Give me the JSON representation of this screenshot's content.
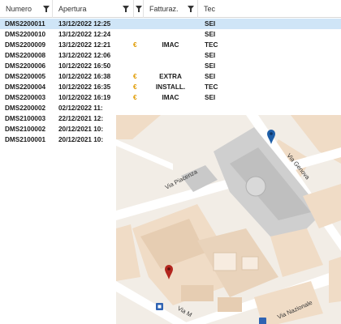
{
  "grid": {
    "columns": [
      {
        "label": "Numero",
        "filter": true
      },
      {
        "label": "Apertura",
        "filter": true
      },
      {
        "label": "",
        "filter": true
      },
      {
        "label": "Fatturaz.",
        "filter": true
      },
      {
        "label": "Tec",
        "filter": false
      }
    ],
    "rows": [
      {
        "numero": "DMS2200011",
        "apertura": "13/12/2022 12:25",
        "euro": "",
        "fatt": "",
        "tec": "SEI",
        "selected": true
      },
      {
        "numero": "DMS2200010",
        "apertura": "13/12/2022 12:24",
        "euro": "",
        "fatt": "",
        "tec": "SEI"
      },
      {
        "numero": "DMS2200009",
        "apertura": "13/12/2022 12:21",
        "euro": "€",
        "fatt": "IMAC",
        "tec": "TEC"
      },
      {
        "numero": "DMS2200008",
        "apertura": "13/12/2022 12:06",
        "euro": "",
        "fatt": "",
        "tec": "SEI"
      },
      {
        "numero": "DMS2200006",
        "apertura": "10/12/2022 16:50",
        "euro": "",
        "fatt": "",
        "tec": "SEI"
      },
      {
        "numero": "DMS2200005",
        "apertura": "10/12/2022 16:38",
        "euro": "€",
        "fatt": "EXTRA",
        "tec": "SEI"
      },
      {
        "numero": "DMS2200004",
        "apertura": "10/12/2022 16:35",
        "euro": "€",
        "fatt": "INSTALL.",
        "tec": "TEC"
      },
      {
        "numero": "DMS2200003",
        "apertura": "10/12/2022 16:19",
        "euro": "€",
        "fatt": "IMAC",
        "tec": "SEI"
      },
      {
        "numero": "DMS2200002",
        "apertura": "02/12/2022 11:",
        "euro": "",
        "fatt": "",
        "tec": ""
      },
      {
        "numero": "DMS2100003",
        "apertura": "22/12/2021 12:",
        "euro": "",
        "fatt": "",
        "tec": ""
      },
      {
        "numero": "DMS2100002",
        "apertura": "20/12/2021 10:",
        "euro": "",
        "fatt": "",
        "tec": ""
      },
      {
        "numero": "DMS2100001",
        "apertura": "20/12/2021 10:",
        "euro": "",
        "fatt": "",
        "tec": ""
      }
    ]
  },
  "map": {
    "streets": [
      "Via Piacenza",
      "Via Genova",
      "Via Nazionale",
      "Via M"
    ],
    "pins": [
      {
        "name": "blue-pin",
        "color": "#1f5fa8"
      },
      {
        "name": "red-pin",
        "color": "#b3261e"
      }
    ],
    "colors": {
      "background": "#f2ede6",
      "block": "#f0dcc6",
      "block_dark": "#e6cdb2",
      "gray_block": "#c9c9c9",
      "road": "#ffffff",
      "transit": "#2f63b3"
    }
  }
}
